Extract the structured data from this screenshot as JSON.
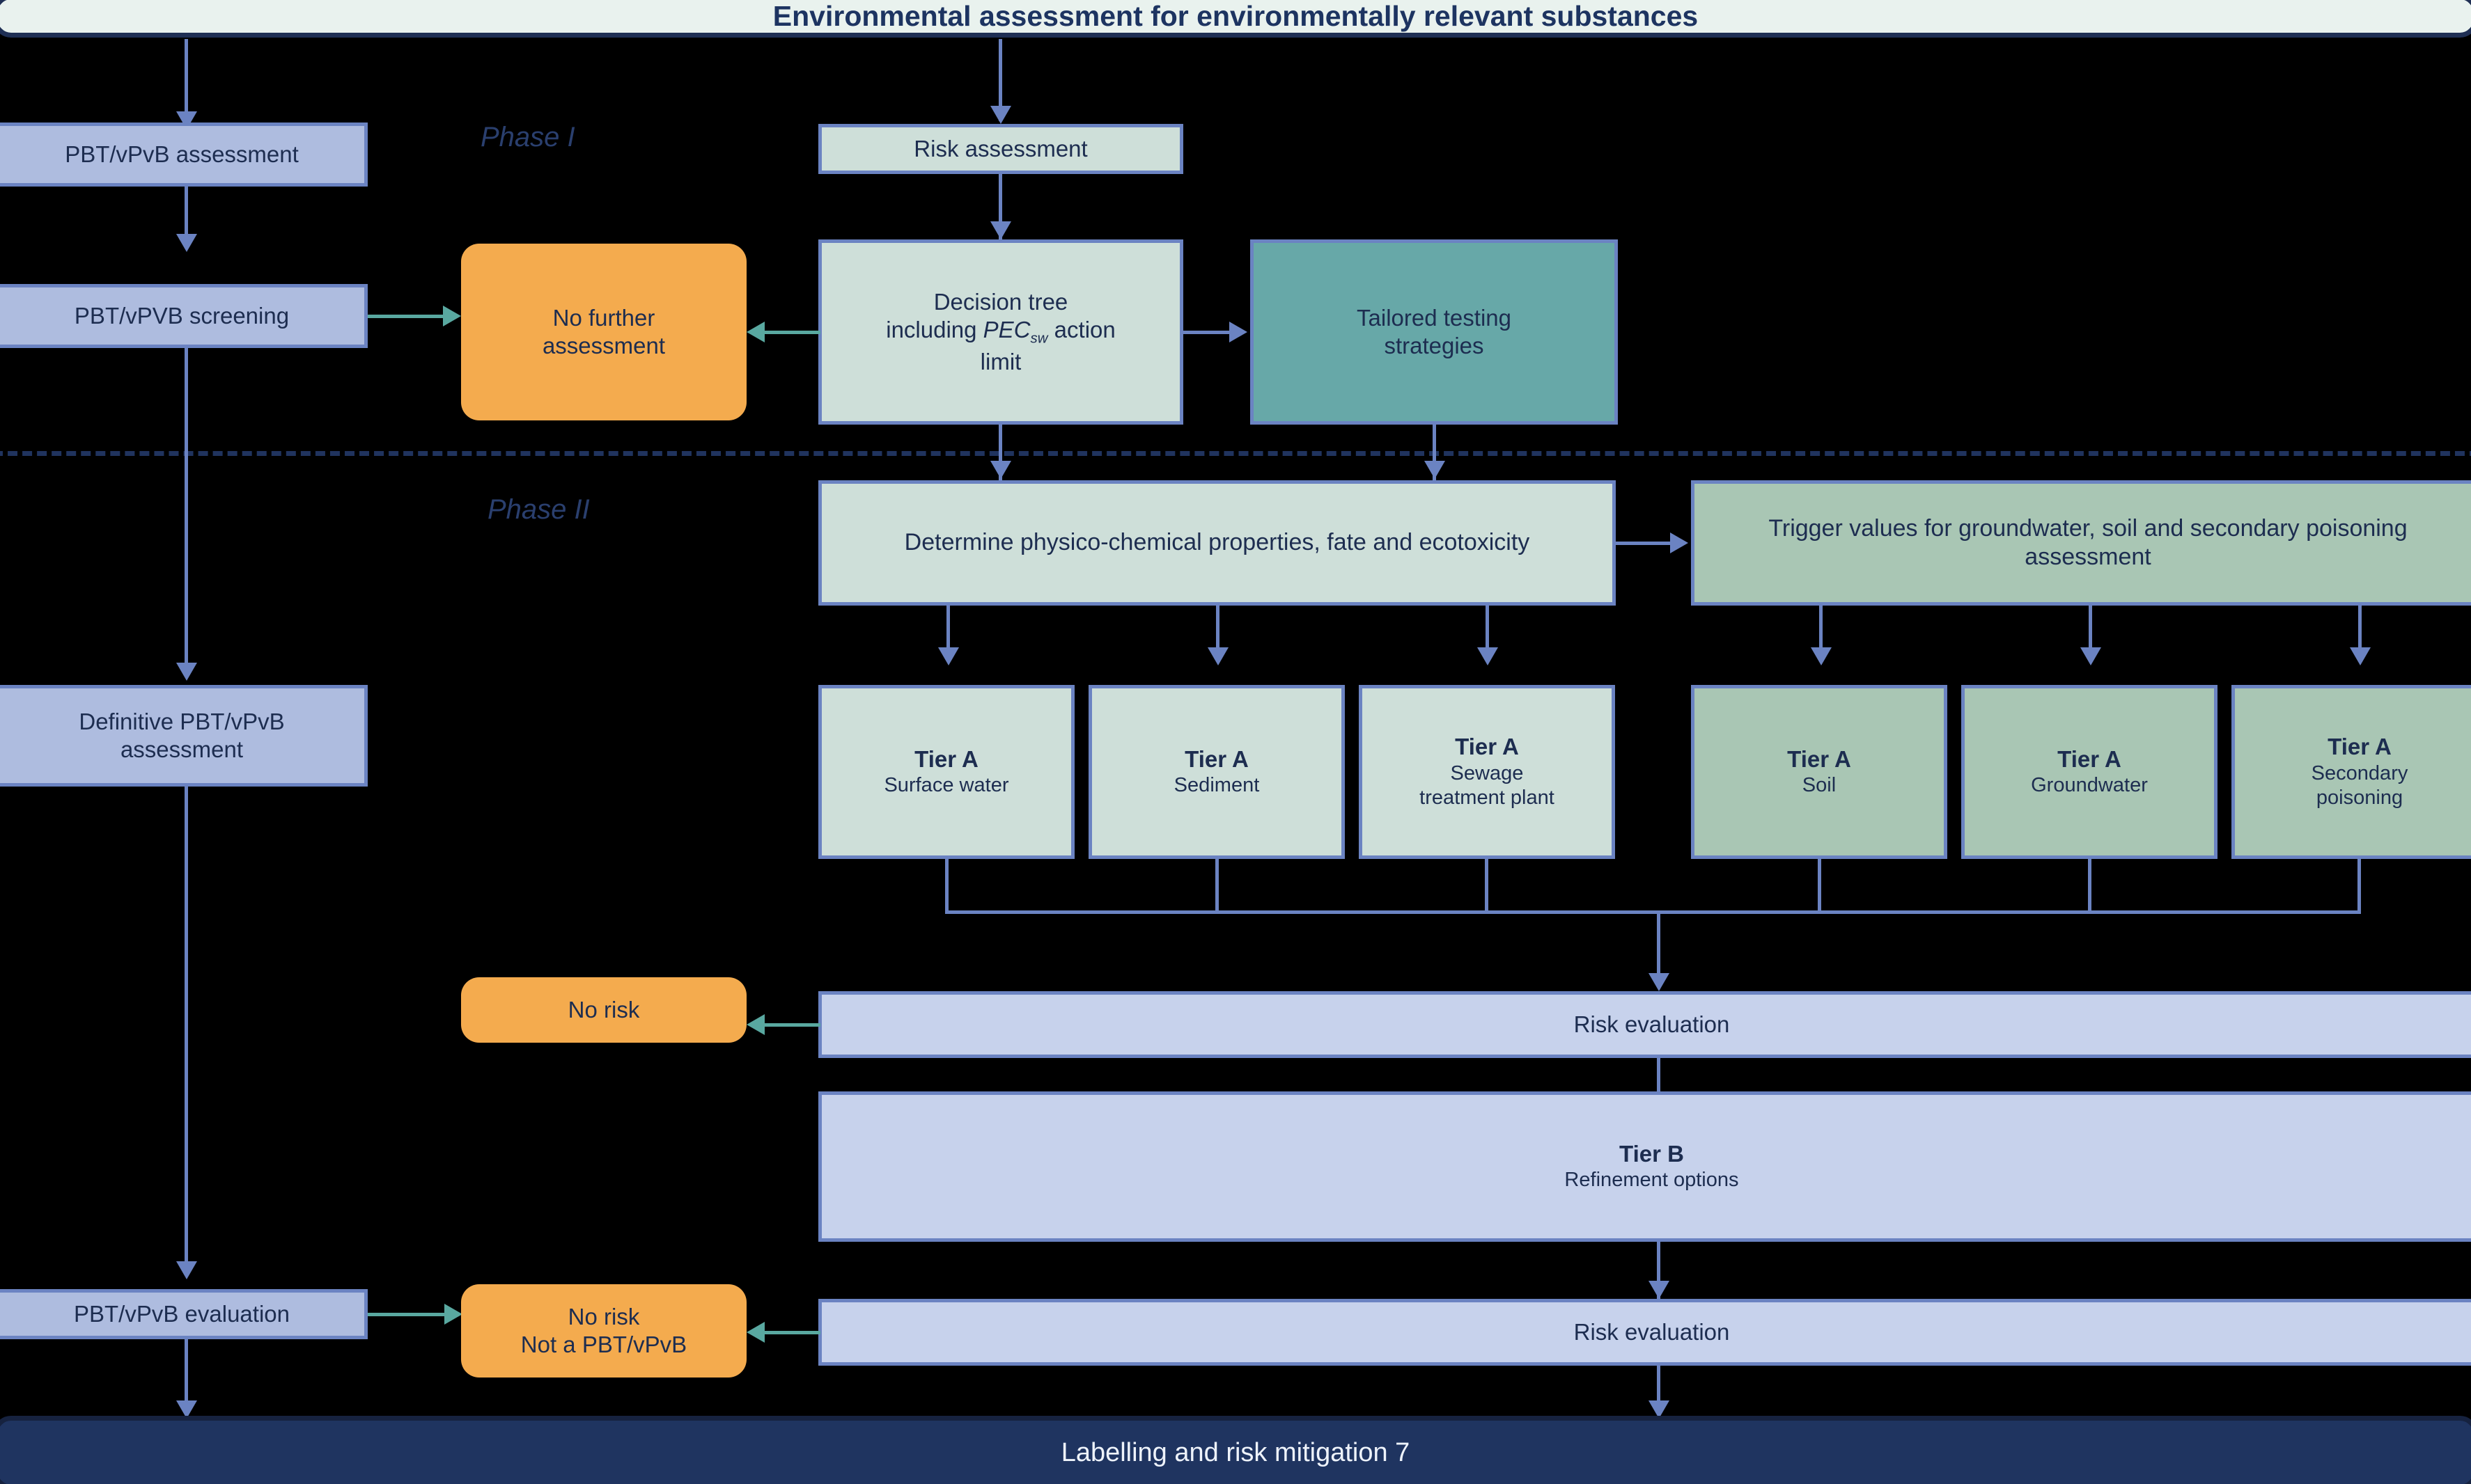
{
  "header": {
    "title": "Environmental assessment for environmentally relevant substances"
  },
  "footer": {
    "title": "Labelling and risk mitigation 7"
  },
  "phases": {
    "phase1": "Phase I",
    "phase2": "Phase II"
  },
  "left_column": {
    "pbt_assessment": "PBT/vPvB assessment",
    "pbt_screening": "PBT/vPVB screening",
    "definitive_pbt": "Definitive PBT/vPvB assessment",
    "pbt_evaluation": "PBT/vPvB evaluation"
  },
  "phase1": {
    "risk_assessment": "Risk assessment",
    "decision_tree_line1": "Decision tree",
    "decision_tree_line2_a": "including ",
    "decision_tree_pec": "PEC",
    "decision_tree_pec_sub": "sw",
    "decision_tree_line2_b": " action",
    "decision_tree_line3": "limit",
    "no_further_assessment": "No further assessment",
    "tailored_testing": "Tailored testing strategies"
  },
  "phase2": {
    "determine_props": "Determine physico-chemical properties, fate and ecotoxicity",
    "trigger_values": "Trigger values for groundwater, soil and secondary poisoning assessment",
    "tier_a_label": "Tier A",
    "tiers_left": [
      {
        "tier": "Tier A",
        "compartment": "Surface water"
      },
      {
        "tier": "Tier A",
        "compartment": "Sediment"
      },
      {
        "tier": "Tier A",
        "compartment": "Sewage treatment plant"
      }
    ],
    "tiers_right": [
      {
        "tier": "Tier A",
        "compartment": "Soil"
      },
      {
        "tier": "Tier A",
        "compartment": "Groundwater"
      },
      {
        "tier": "Tier A",
        "compartment": "Secondary poisoning"
      }
    ],
    "risk_evaluation_1": "Risk evaluation",
    "risk_evaluation_2": "Risk evaluation",
    "no_risk": "No risk",
    "tier_b_title": "Tier B",
    "tier_b_sub": "Refinement options",
    "no_risk_not_pbt_line1": "No risk",
    "no_risk_not_pbt_line2": "Not a PBT/vPvB"
  },
  "colors": {
    "header_fill": "#e9f2ee",
    "header_text": "#1d3461",
    "footer_fill": "#1f3460",
    "footer_text": "#eef3fb",
    "blue_fill": "#aebcdf",
    "blue_light_fill": "#c7d2ec",
    "mint_fill": "#cedfd9",
    "green_fill": "#a9c6b4",
    "teal_fill": "#67a8a8",
    "orange_fill": "#f4ab4e",
    "border_blue": "#6b83c2",
    "connector_blue": "#6b83c2",
    "connector_teal": "#59a8a0",
    "text_dark": "#1d2d50",
    "divider": "#20335e"
  }
}
